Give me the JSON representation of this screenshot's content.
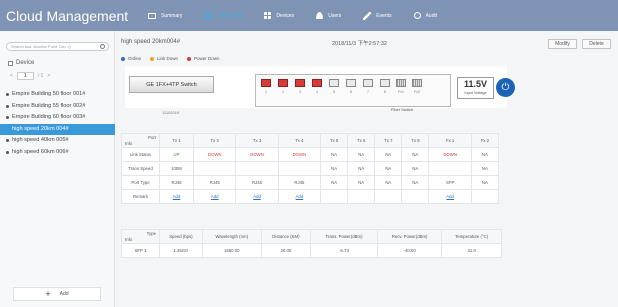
{
  "app": {
    "title": "Cloud Management"
  },
  "nav": [
    {
      "label": "Summary",
      "icon": "monitor-icon"
    },
    {
      "label": "Device Info",
      "icon": "device-icon",
      "active": true
    },
    {
      "label": "Devices",
      "icon": "grid-icon"
    },
    {
      "label": "Users",
      "icon": "user-icon"
    },
    {
      "label": "Events",
      "icon": "pen-icon"
    },
    {
      "label": "Audit",
      "icon": "clock-icon"
    }
  ],
  "sidebar": {
    "search_placeholder": "Search Ass. Monitor Point, Dev Q",
    "root_label": "Device",
    "pager": {
      "prev": "<",
      "page": "1",
      "total": "/ 1",
      "next": ">"
    },
    "items": [
      {
        "label": "Empire Building 50 floor 001#",
        "selected": false
      },
      {
        "label": "Empire Building 55 floor 002#",
        "selected": false
      },
      {
        "label": "Empire Building 60 floor 003#",
        "selected": false
      },
      {
        "label": "high speed 20km 004#",
        "selected": true
      },
      {
        "label": "high speed 40km 005#",
        "selected": false
      },
      {
        "label": "high speed 60km 006#",
        "selected": false
      }
    ],
    "add_label": "Add"
  },
  "main": {
    "title": "high speed 20km004#",
    "datetime": "2018/11/3 下午2:57:32",
    "modify_label": "Modify",
    "delete_label": "Delete",
    "legend": [
      {
        "label": "Online",
        "color": "#2c6fc4"
      },
      {
        "label": "Link Down",
        "color": "#f0a020"
      },
      {
        "label": "Power Down",
        "color": "#d83a3a"
      }
    ]
  },
  "device": {
    "model": "GE 1FX+4TP Switch",
    "serial": "11102019",
    "ports": [
      {
        "num": "1",
        "state": "up"
      },
      {
        "num": "2",
        "state": "up"
      },
      {
        "num": "3",
        "state": "up"
      },
      {
        "num": "4",
        "state": "up"
      },
      {
        "num": "5",
        "state": "off"
      },
      {
        "num": "6",
        "state": "off"
      },
      {
        "num": "7",
        "state": "off"
      },
      {
        "num": "8",
        "state": "off"
      },
      {
        "num": "Fx1",
        "state": "fx"
      },
      {
        "num": "Fx2",
        "state": "fx"
      }
    ],
    "port_caption": "Fiber Switch",
    "voltage": "11.5V",
    "voltage_label": "Input Voltage",
    "power_icon": "power-icon"
  },
  "port_table": {
    "corner_top": "Port",
    "corner_bottom": "Info",
    "columns": [
      "Tx 1",
      "Tx 2",
      "Tx 3",
      "Tx 4",
      "Tx 5",
      "Tx 6",
      "Tx 7",
      "Tx 8",
      "Fx 1",
      "Fx 2"
    ],
    "rows": [
      {
        "label": "Link Status",
        "cells": [
          "UP",
          "DOWN",
          "DOWN",
          "DOWN",
          "NA",
          "NA",
          "NA",
          "NA",
          "DOWN",
          "NA"
        ]
      },
      {
        "label": "Trans Speed",
        "cells": [
          "100M",
          "",
          "",
          "",
          "NA",
          "NA",
          "NA",
          "NA",
          "",
          "NA"
        ]
      },
      {
        "label": "Port Type",
        "cells": [
          "RJ45",
          "RJ45",
          "RJ45",
          "RJ45",
          "NA",
          "NA",
          "NA",
          "NA",
          "SFP",
          "NA"
        ]
      },
      {
        "label": "Remark",
        "cells": [
          "Add",
          "Add",
          "Add",
          "Add",
          "",
          "",
          "",
          "",
          "Add",
          ""
        ]
      }
    ]
  },
  "sfp_table": {
    "corner_top": "Type",
    "corner_bottom": "Info",
    "columns": [
      "Speed (bps)",
      "Wavelength (nm)",
      "Distance (KM)",
      "Trans. Power(dBm)",
      "Recv. Power(dBm)",
      "Temperature (°C)"
    ],
    "rows": [
      {
        "label": "SFP 1",
        "cells": [
          "1.25GG",
          "1550.00",
          "20.00",
          "-6.73",
          "-40.00",
          "31.0"
        ]
      }
    ]
  }
}
